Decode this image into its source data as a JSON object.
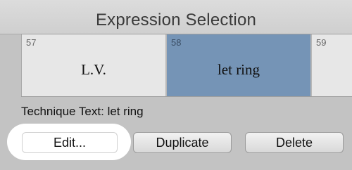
{
  "window": {
    "title": "Expression Selection"
  },
  "grid": {
    "cells": [
      {
        "number": "57",
        "text": "L.V.",
        "selected": false
      },
      {
        "number": "58",
        "text": "let ring",
        "selected": true
      },
      {
        "number": "59",
        "text": "",
        "selected": false
      }
    ]
  },
  "technique": {
    "label": "Technique Text:",
    "value": "let ring"
  },
  "buttons": {
    "edit_label": "Edit...",
    "duplicate_label": "Duplicate",
    "delete_label": "Delete"
  },
  "colors": {
    "selection": "#7594b6",
    "highlight": "#ffffff"
  }
}
